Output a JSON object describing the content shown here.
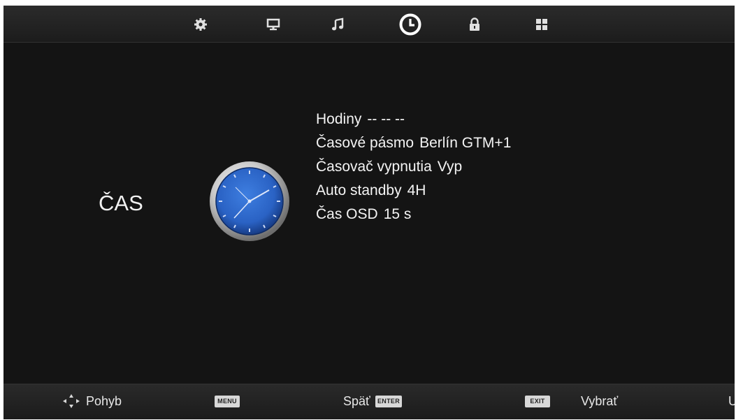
{
  "tabs": [
    {
      "icon": "gear-icon",
      "name": "tab-setup",
      "active": false
    },
    {
      "icon": "monitor-icon",
      "name": "tab-picture",
      "active": false
    },
    {
      "icon": "music-note-icon",
      "name": "tab-sound",
      "active": false
    },
    {
      "icon": "clock-icon",
      "name": "tab-time",
      "active": true
    },
    {
      "icon": "lock-icon",
      "name": "tab-lock",
      "active": false
    },
    {
      "icon": "grid-icon",
      "name": "tab-option",
      "active": false
    }
  ],
  "section": {
    "title": "ČAS",
    "icon": "clock-icon"
  },
  "menu": [
    {
      "label": "Hodiny",
      "value": "-- -- --"
    },
    {
      "label": "Časové pásmo",
      "value": "Berlín GTM+1"
    },
    {
      "label": "Časovač vypnutia",
      "value": "Vyp"
    },
    {
      "label": "Auto standby",
      "value": "4H"
    },
    {
      "label": "Čas OSD",
      "value": "15 s"
    }
  ],
  "footer": {
    "move_icon": "arrows-navigate-icon",
    "move_label": "Pohyb",
    "menu_key": "MENU",
    "back_label": "Späť",
    "enter_key": "ENTER",
    "exit_key": "EXIT",
    "select_label": "Vybrať",
    "truncated_label": "U"
  },
  "colors": {
    "background": "#141414",
    "bar": "#222222",
    "text": "#f4f4f4",
    "clock_face": "#2a62c4"
  }
}
